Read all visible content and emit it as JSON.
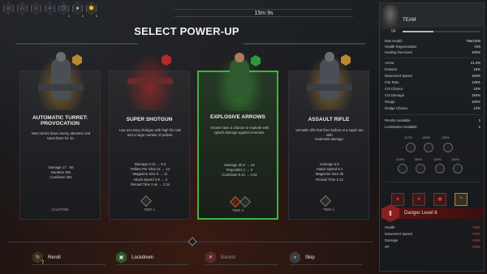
{
  "top_bar": {
    "icons": [
      {
        "name": "skull-icon",
        "count": ""
      },
      {
        "name": "claw-icon",
        "count": ""
      },
      {
        "name": "claw-icon",
        "count": ""
      },
      {
        "name": "wave-icon",
        "count": ""
      },
      {
        "name": "hexagon-icon",
        "count": "1"
      },
      {
        "name": "grenade-icon",
        "count": "1"
      },
      {
        "name": "hexagon-gold-icon",
        "count": "3"
      }
    ],
    "timer": "15m 9s"
  },
  "title": "SELECT POWER-UP",
  "cards": [
    {
      "name": "AUTOMATIC TURRET:\nPROVOCATION",
      "desc": "New turrets draw enemy attention and\ntaunt them for 4s.",
      "stats": [
        "Damage 17 · 50",
        "Duration 20s",
        "Cooldown 26s"
      ],
      "footer": "CAUTION"
    },
    {
      "name": "SUPER SHOTGUN",
      "desc": "Low accuracy shotgun with high fire rate\nand a large number of pellets.",
      "stats": [
        "Damage 8.13 → 9.3",
        "Pellets Per Shot 12 → 14",
        "Magazine Size 9 → 11",
        "Attack Speed 2.8 → 3",
        "Reload Time 2.4s → 2.1s"
      ],
      "footer": "TIER 1"
    },
    {
      "name": "EXPLOSIVE ARROWS",
      "desc": "Arrows have a chance to explode with\nsplash damage against enemies.",
      "stats": [
        "Damage 20.2 → 23",
        "Projectiles 1 → 2",
        "Cooldown 5.1s → 4.5s"
      ],
      "footer": "TIER 3"
    },
    {
      "name": "ASSAULT RIFLE",
      "desc": "Versatile rifle that fires bullets at a rapid rate with\nmoderate damage.",
      "stats": [
        "Damage 6.9",
        "Attack Speed 6.1",
        "Magazine Size 35",
        "Reload Time 2.1s"
      ],
      "footer": "TIER 1"
    }
  ],
  "actions": [
    {
      "label": "Reroll",
      "count": "7",
      "icon": "reroll-icon"
    },
    {
      "label": "Lockdown",
      "count": "",
      "icon": "lock-icon"
    },
    {
      "label": "Banish",
      "count": "",
      "icon": "banish-icon"
    },
    {
      "label": "Skip",
      "count": "",
      "icon": "skip-icon"
    }
  ],
  "team": {
    "title": "TEAM",
    "level": "54",
    "stats_a": [
      {
        "k": "Max Health",
        "v": "756/1000"
      },
      {
        "k": "Health Regeneration",
        "v": "+8/s"
      },
      {
        "k": "Healing Received",
        "v": "100%"
      }
    ],
    "stats_b": [
      {
        "k": "Armor",
        "v": "21.3%"
      },
      {
        "k": "Evasion",
        "v": "15%"
      },
      {
        "k": "Movement Speed",
        "v": "160%"
      },
      {
        "k": "Fire Rate",
        "v": "125%"
      },
      {
        "k": "Crit Chance",
        "v": "10%"
      },
      {
        "k": "Crit Damage",
        "v": "150%"
      },
      {
        "k": "Range",
        "v": "100%"
      },
      {
        "k": "Dodge Chance",
        "v": "13%"
      }
    ],
    "stats_c": [
      {
        "k": "Rerolls Available",
        "v": "2"
      },
      {
        "k": "Lockdowns Available",
        "v": "1"
      }
    ],
    "weapons": [
      {
        "lbl": "127%"
      },
      {
        "lbl": "125%"
      },
      {
        "lbl": "135%"
      },
      {
        "lbl": "143%"
      },
      {
        "lbl": "130%"
      },
      {
        "lbl": "110%"
      },
      {
        "lbl": "120%"
      }
    ],
    "danger_level": "Danger Level 6",
    "danger_stats": [
      {
        "k": "Health",
        "v": "+25%"
      },
      {
        "k": "Movement Speed",
        "v": "+10%"
      },
      {
        "k": "Damage",
        "v": "+15%"
      },
      {
        "k": "XP",
        "v": "+30%"
      }
    ]
  }
}
